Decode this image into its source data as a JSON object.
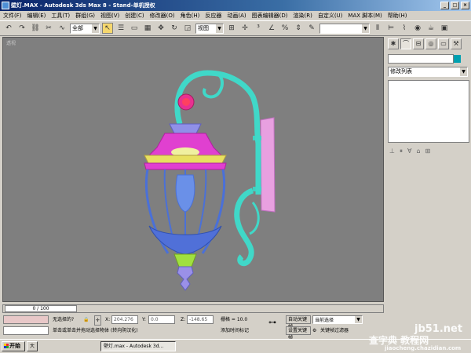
{
  "window": {
    "title": "壁灯.MAX - Autodesk 3ds Max 8 - Stand-单机授权",
    "buttons": [
      "_",
      "□",
      "×"
    ]
  },
  "menubar": [
    "文件(F)",
    "编辑(E)",
    "工具(T)",
    "群组(G)",
    "视图(V)",
    "创建(C)",
    "修改器(O)",
    "角色(H)",
    "反应器",
    "动画(A)",
    "图表编辑器(D)",
    "渲染(R)",
    "自定义(U)",
    "MAX 脚本(M)",
    "帮助(H)"
  ],
  "toolbar": {
    "selection_filter": "全部",
    "reference_coord": "视图"
  },
  "viewport": {
    "label": "透视",
    "accent": "#7f7f7f"
  },
  "command_panel": {
    "modifier_list": "修改列表"
  },
  "timeline": {
    "slider": "0 / 100"
  },
  "status": {
    "selection": "无选择的?",
    "x_label": "X:",
    "x_value": "204.276",
    "y_label": "Y:",
    "y_value": "0.0",
    "z_label": "Z:",
    "z_value": "-148.65",
    "grid": "栅格 = 10.0",
    "auto_key": "自动关键帧",
    "set_key": "设置关键帧",
    "key_mode": "当前选择",
    "key_filters": "关键帧过滤器",
    "prompt": "单击或单击并拖动选择物体 (转向阴汉化)",
    "add_time_tag": "添加时间标记"
  },
  "taskbar": {
    "start": "开始",
    "items": [
      "大",
      "壁灯.max - Autodesk 3d..."
    ]
  },
  "watermarks": {
    "w1": "jb51.net",
    "w2": "查字典 教程网",
    "w3": "jiaocheng.chazidian.com"
  }
}
